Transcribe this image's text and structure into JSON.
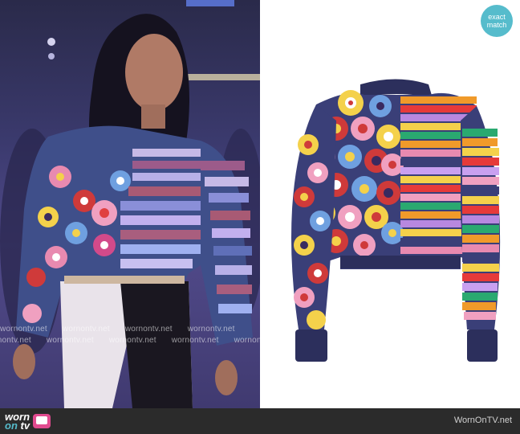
{
  "badge": {
    "line1": "exact",
    "line2": "match"
  },
  "watermark": {
    "text": "wornontv.net"
  },
  "footer": {
    "logo_worn": "worn",
    "logo_on": "on",
    "logo_tv": "tv",
    "site": "WornOnTV.net"
  },
  "colors": {
    "badge": "#56bccc",
    "footer": "#2b2b2b",
    "logo_tv": "#e14b8f"
  }
}
